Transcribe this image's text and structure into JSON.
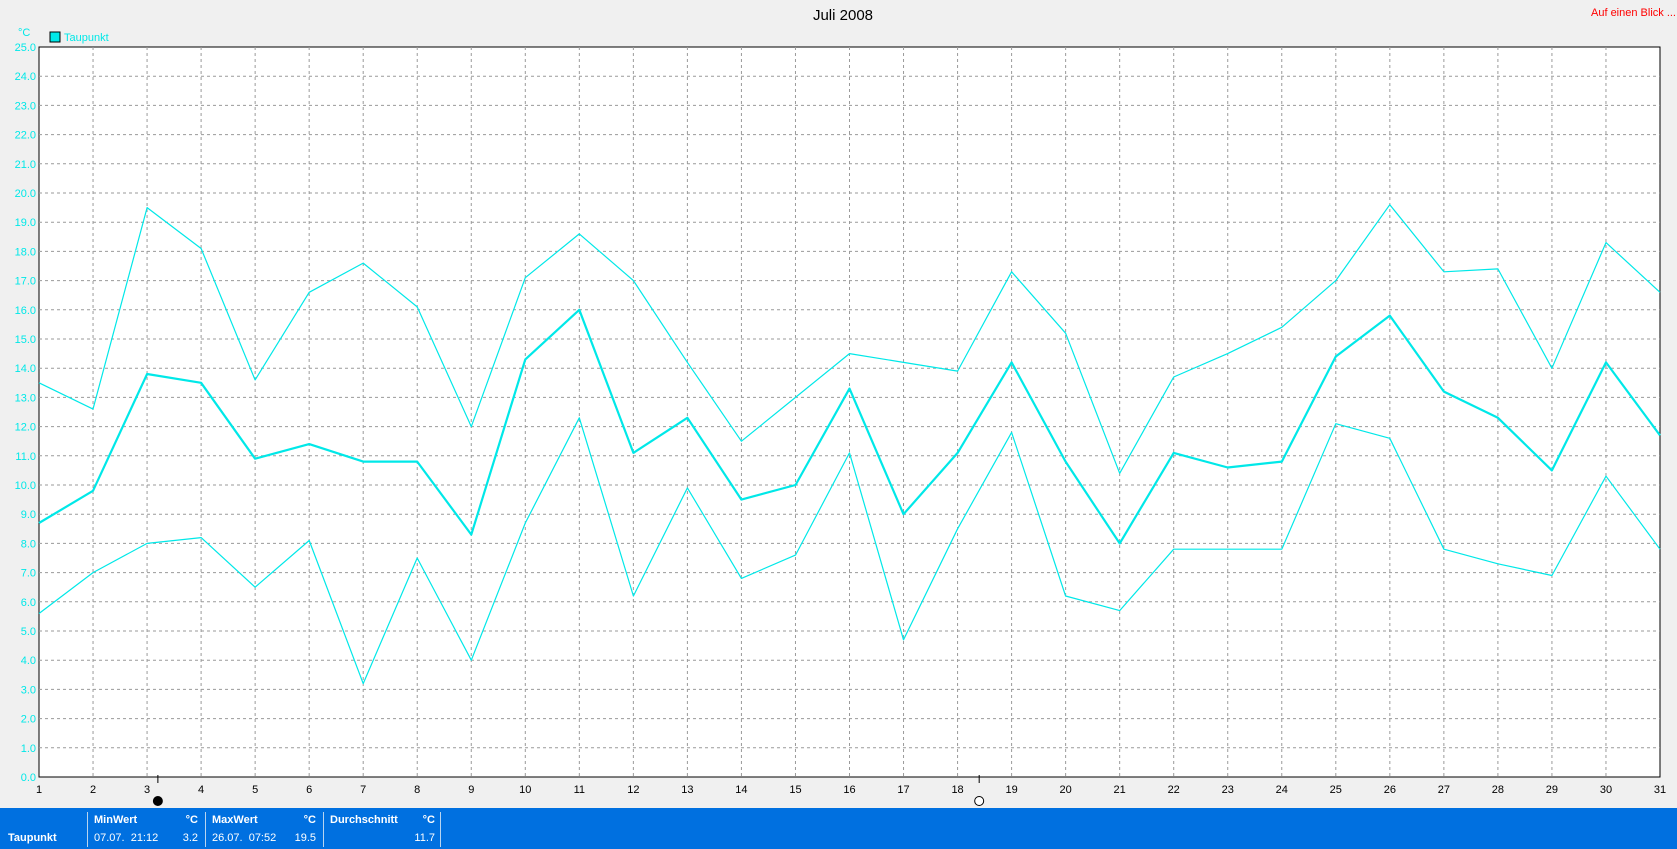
{
  "header": {
    "title": "Juli 2008",
    "link_text": "Auf einen Blick ..."
  },
  "colors": {
    "series": "#00e8e8",
    "grid": "#9a9a9a",
    "link": "#ff0000",
    "stat_bar": "#0070e0"
  },
  "chart_data": {
    "type": "line",
    "title": "Juli 2008",
    "ylabel": "°C",
    "ylim": [
      0,
      25
    ],
    "y_tick_step": 1,
    "grid": true,
    "legend": {
      "position": "top-left",
      "entries": [
        "Taupunkt"
      ]
    },
    "x": [
      1,
      2,
      3,
      4,
      5,
      6,
      7,
      8,
      9,
      10,
      11,
      12,
      13,
      14,
      15,
      16,
      17,
      18,
      19,
      20,
      21,
      22,
      23,
      24,
      25,
      26,
      27,
      28,
      29,
      30,
      31
    ],
    "series": [
      {
        "name": "Taupunkt",
        "role": "max",
        "values": [
          13.5,
          12.6,
          19.5,
          18.1,
          13.6,
          16.6,
          17.6,
          16.1,
          12.0,
          17.1,
          18.6,
          17.0,
          14.2,
          11.5,
          13.0,
          14.5,
          14.2,
          13.9,
          17.3,
          15.2,
          10.4,
          13.7,
          14.5,
          15.4,
          17.0,
          19.6,
          17.3,
          17.4,
          14.0,
          18.3,
          16.6
        ]
      },
      {
        "name": "Taupunkt",
        "role": "avg",
        "values": [
          8.7,
          9.8,
          13.8,
          13.5,
          10.9,
          11.4,
          10.8,
          10.8,
          8.3,
          14.3,
          16.0,
          11.1,
          12.3,
          9.5,
          10.0,
          13.3,
          9.0,
          11.1,
          14.2,
          10.8,
          8.0,
          11.1,
          10.6,
          10.8,
          14.4,
          15.8,
          13.2,
          12.3,
          10.5,
          14.2,
          11.7
        ]
      },
      {
        "name": "Taupunkt",
        "role": "min",
        "values": [
          5.6,
          7.0,
          8.0,
          8.2,
          6.5,
          8.1,
          3.2,
          7.5,
          4.0,
          8.7,
          12.3,
          6.2,
          9.9,
          6.8,
          7.6,
          11.1,
          4.7,
          8.5,
          11.8,
          6.2,
          5.7,
          7.8,
          7.8,
          7.8,
          12.1,
          11.6,
          7.8,
          7.3,
          6.9,
          10.3,
          7.8
        ]
      }
    ],
    "moon_phases": [
      {
        "day": 3.2,
        "phase": "new-moon"
      },
      {
        "day": 18.4,
        "phase": "full-moon"
      }
    ]
  },
  "stats": {
    "label": "Taupunkt",
    "min": {
      "head": "MinWert",
      "unit": "°C",
      "date": "07.07.  21:12",
      "value": "3.2"
    },
    "max": {
      "head": "MaxWert",
      "unit": "°C",
      "date": "26.07.  07:52",
      "value": "19.5"
    },
    "avg": {
      "head": "Durchschnitt",
      "unit": "°C",
      "value": "11.7"
    }
  }
}
